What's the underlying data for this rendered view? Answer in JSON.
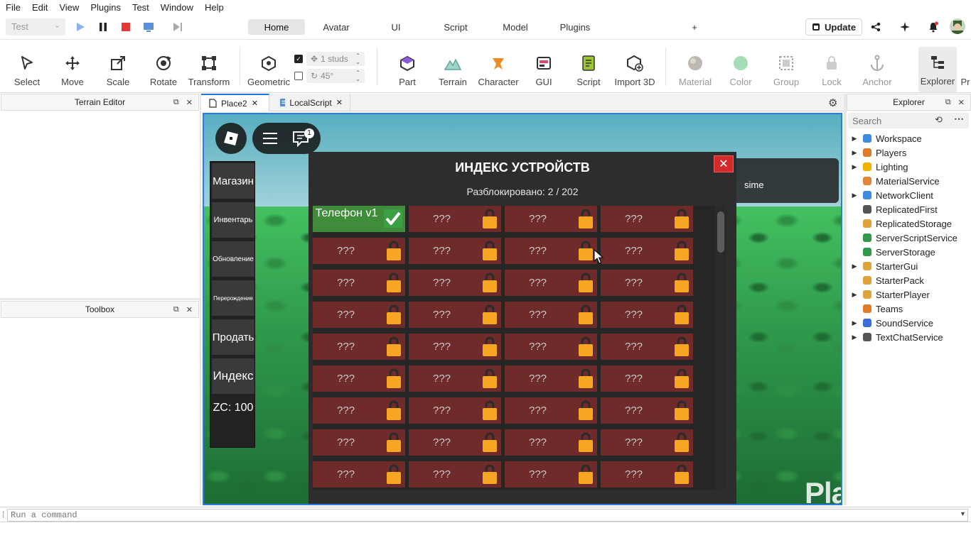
{
  "menu": [
    "File",
    "Edit",
    "View",
    "Plugins",
    "Test",
    "Window",
    "Help"
  ],
  "mode_select": {
    "value": "Test"
  },
  "ribbon_tabs": [
    "Home",
    "Avatar",
    "UI",
    "Script",
    "Model",
    "Plugins"
  ],
  "ribbon_add": "+",
  "update_label": "Update",
  "tools": {
    "select": "Select",
    "move": "Move",
    "scale": "Scale",
    "rotate": "Rotate",
    "transform": "Transform",
    "geometric": "Geometric",
    "move_increment": "1 studs",
    "rotate_increment": "45°",
    "part": "Part",
    "terrain": "Terrain",
    "character": "Character",
    "gui": "GUI",
    "script": "Script",
    "import3d": "Import 3D",
    "material": "Material",
    "color": "Color",
    "group": "Group",
    "lock": "Lock",
    "anchor": "Anchor",
    "explorer": "Explorer",
    "properties_cut": "Pr"
  },
  "panels": {
    "terrain_editor": "Terrain Editor",
    "toolbox": "Toolbox",
    "explorer": "Explorer"
  },
  "doc_tabs": [
    "Place2",
    "LocalScript"
  ],
  "game": {
    "chat_badge": "1",
    "side_menu": [
      "Магазин",
      "Инвентарь",
      "Обновление",
      "Перерождение",
      "Продать",
      "Индекс",
      "ZC: 100"
    ],
    "index_title": "ИНДЕКС УСТРОЙСТВ",
    "index_subtitle": "Разблокировано: 2 / 202",
    "close_glyph": "✕",
    "unlocked_item": "Телефон v1",
    "locked_label": "???",
    "notification": "sime",
    "watermark": "Playerok"
  },
  "explorer": {
    "search_placeholder": "Search",
    "items": [
      {
        "name": "Workspace",
        "expand": true,
        "icon": "globe-icon",
        "color": "#3a8dde"
      },
      {
        "name": "Players",
        "expand": true,
        "icon": "players-icon",
        "color": "#e07b2a"
      },
      {
        "name": "Lighting",
        "expand": true,
        "icon": "bulb-icon",
        "color": "#f0b400"
      },
      {
        "name": "MaterialService",
        "expand": false,
        "icon": "material-icon",
        "color": "#e0863a"
      },
      {
        "name": "NetworkClient",
        "expand": true,
        "icon": "network-icon",
        "color": "#3a8dde"
      },
      {
        "name": "ReplicatedFirst",
        "expand": false,
        "icon": "replicated-first-icon",
        "color": "#555555"
      },
      {
        "name": "ReplicatedStorage",
        "expand": false,
        "icon": "replicated-storage-icon",
        "color": "#e0a23a"
      },
      {
        "name": "ServerScriptService",
        "expand": false,
        "icon": "server-script-icon",
        "color": "#2f9a4b"
      },
      {
        "name": "ServerStorage",
        "expand": false,
        "icon": "server-storage-icon",
        "color": "#2f9a4b"
      },
      {
        "name": "StarterGui",
        "expand": true,
        "icon": "starter-gui-icon",
        "color": "#e0a23a"
      },
      {
        "name": "StarterPack",
        "expand": false,
        "icon": "starter-pack-icon",
        "color": "#e0a23a"
      },
      {
        "name": "StarterPlayer",
        "expand": true,
        "icon": "starter-player-icon",
        "color": "#e0a23a"
      },
      {
        "name": "Teams",
        "expand": false,
        "icon": "teams-icon",
        "color": "#e07b2a"
      },
      {
        "name": "SoundService",
        "expand": true,
        "icon": "sound-icon",
        "color": "#3a6ede"
      },
      {
        "name": "TextChatService",
        "expand": true,
        "icon": "chat-icon",
        "color": "#555555"
      }
    ]
  },
  "command_bar": {
    "placeholder": "Run a command"
  }
}
